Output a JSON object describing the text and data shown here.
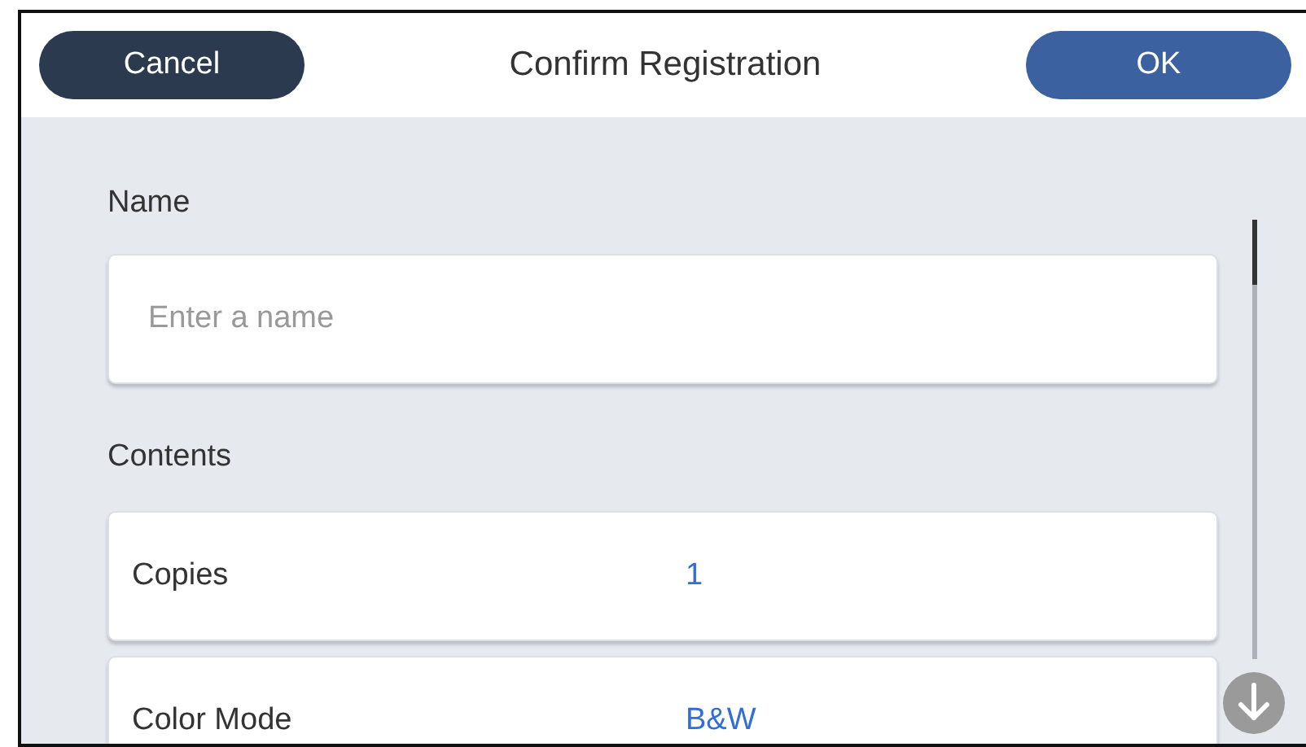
{
  "header": {
    "cancel_button": "Cancel",
    "title": "Confirm Registration",
    "ok_button": "OK"
  },
  "name_section": {
    "label": "Name",
    "placeholder": "Enter a name"
  },
  "contents_section": {
    "label": "Contents",
    "rows": [
      {
        "label": "Copies",
        "value": "1"
      },
      {
        "label": "Color Mode",
        "value": "B&W"
      }
    ]
  }
}
